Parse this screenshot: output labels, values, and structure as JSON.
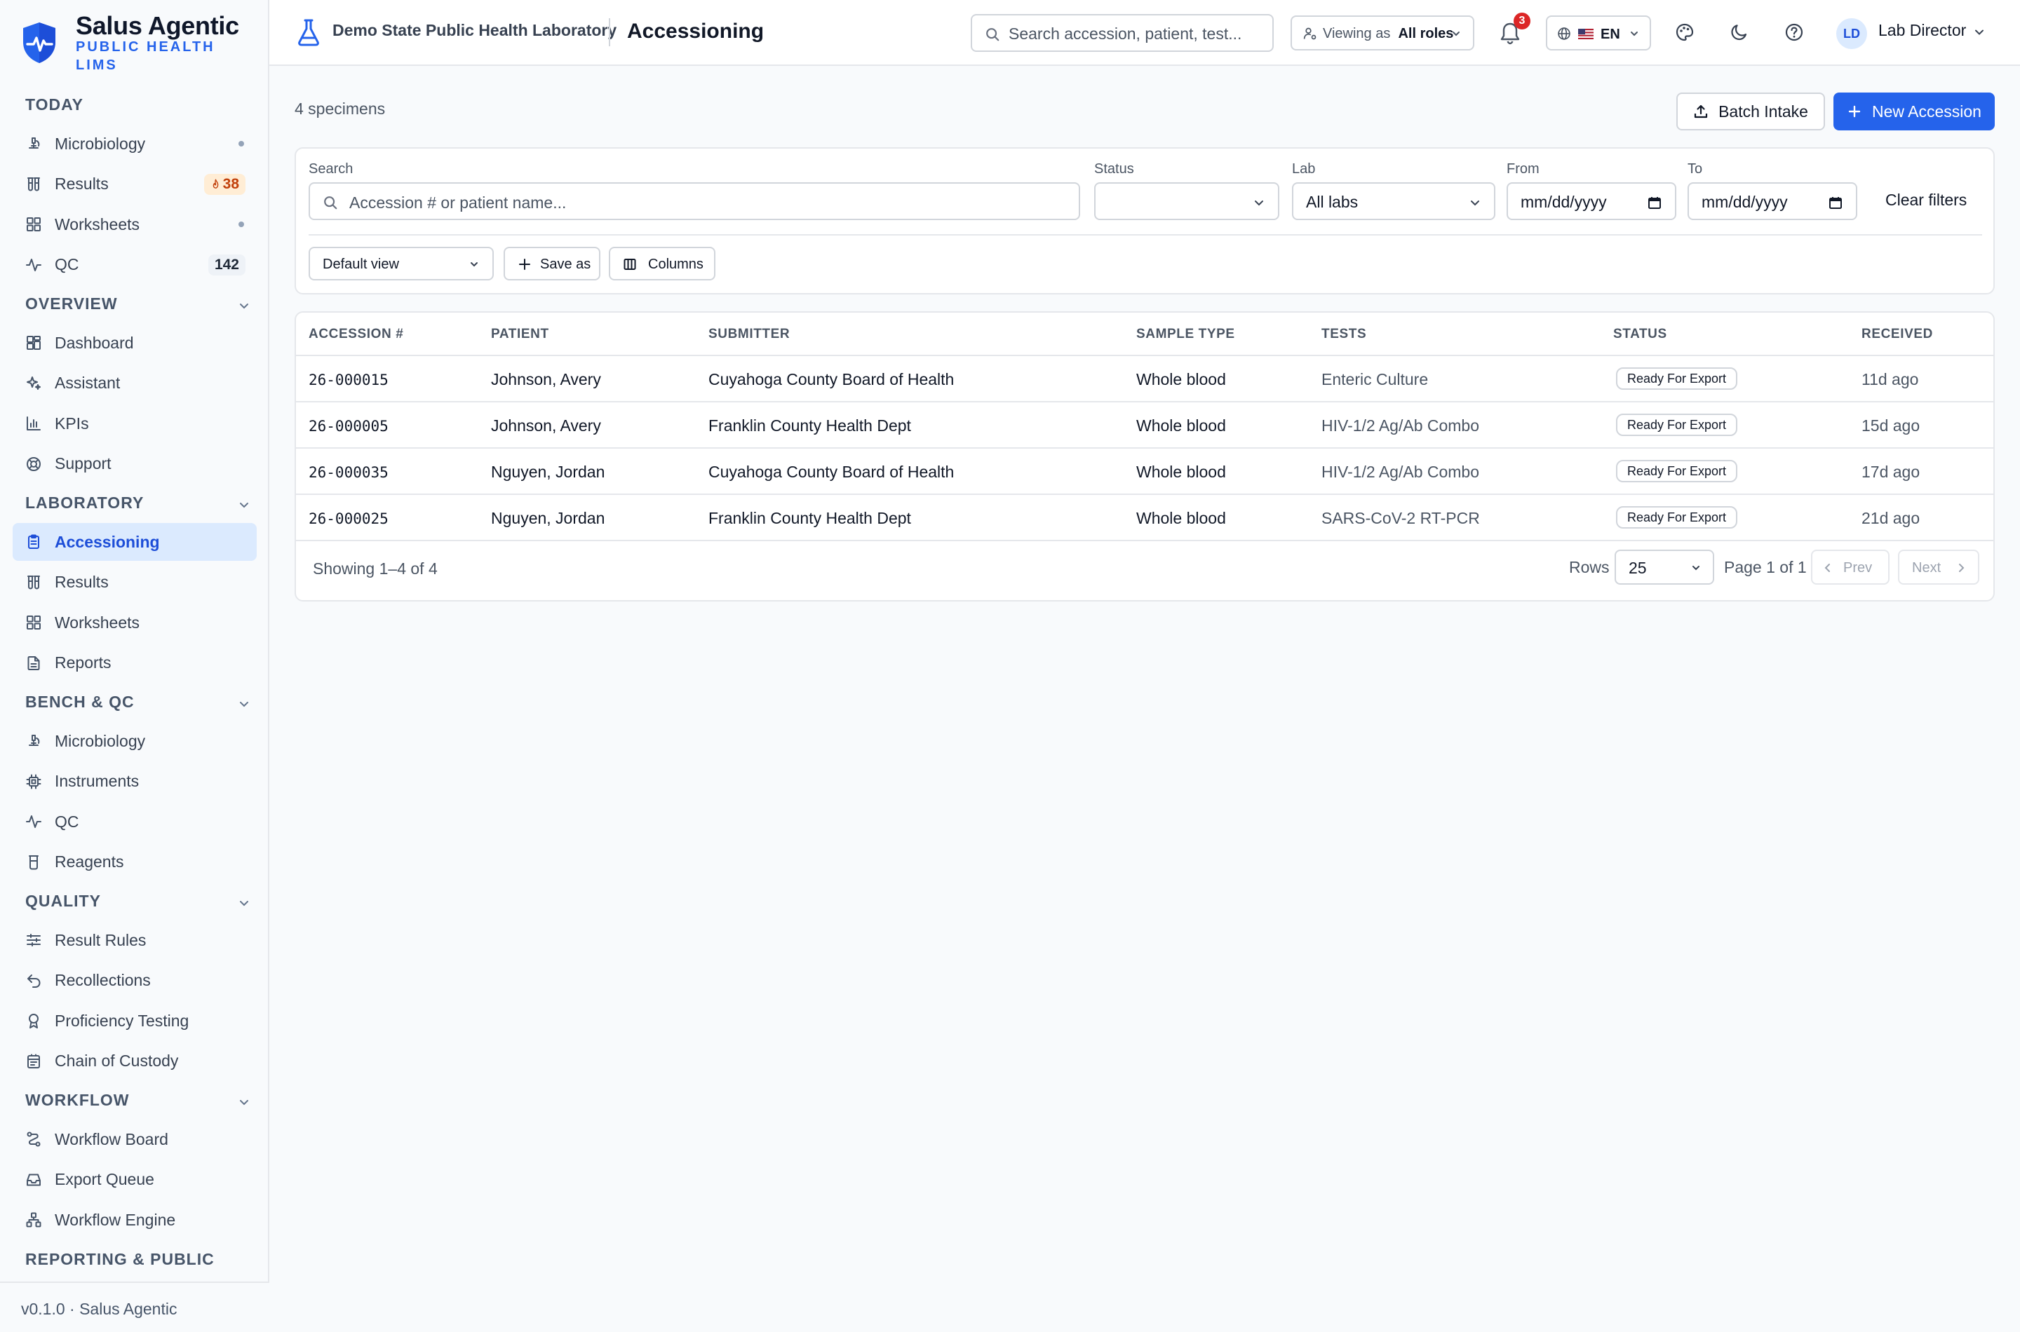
{
  "brand": {
    "name": "Salus Agentic",
    "subtitle": "PUBLIC HEALTH LIMS",
    "version_footer": "v0.1.0 · Salus Agentic"
  },
  "sidebar": {
    "sections": [
      {
        "title": "TODAY",
        "items": [
          {
            "label": "Microbiology",
            "icon": "microscope-icon",
            "dot": true
          },
          {
            "label": "Results",
            "icon": "test-tubes-icon",
            "badge": "38",
            "badge_icon": "flame-icon"
          },
          {
            "label": "Worksheets",
            "icon": "grid-icon",
            "dot": true
          },
          {
            "label": "QC",
            "icon": "activity-icon",
            "badge": "142"
          }
        ]
      },
      {
        "title": "OVERVIEW",
        "items": [
          {
            "label": "Dashboard",
            "icon": "dashboard-icon"
          },
          {
            "label": "Assistant",
            "icon": "sparkles-icon"
          },
          {
            "label": "KPIs",
            "icon": "bar-chart-icon"
          },
          {
            "label": "Support",
            "icon": "life-buoy-icon"
          }
        ]
      },
      {
        "title": "LABORATORY",
        "items": [
          {
            "label": "Accessioning",
            "icon": "clipboard-icon",
            "active": true
          },
          {
            "label": "Results",
            "icon": "test-tubes-icon"
          },
          {
            "label": "Worksheets",
            "icon": "grid-icon"
          },
          {
            "label": "Reports",
            "icon": "file-text-icon"
          }
        ]
      },
      {
        "title": "BENCH & QC",
        "items": [
          {
            "label": "Microbiology",
            "icon": "microscope-icon"
          },
          {
            "label": "Instruments",
            "icon": "cpu-icon"
          },
          {
            "label": "QC",
            "icon": "activity-icon"
          },
          {
            "label": "Reagents",
            "icon": "beaker-icon"
          }
        ]
      },
      {
        "title": "QUALITY",
        "items": [
          {
            "label": "Result Rules",
            "icon": "sliders-icon"
          },
          {
            "label": "Recollections",
            "icon": "undo-icon"
          },
          {
            "label": "Proficiency Testing",
            "icon": "award-icon"
          },
          {
            "label": "Chain of Custody",
            "icon": "clipboard-list-icon"
          }
        ]
      },
      {
        "title": "WORKFLOW",
        "items": [
          {
            "label": "Workflow Board",
            "icon": "route-icon"
          },
          {
            "label": "Export Queue",
            "icon": "inbox-icon"
          },
          {
            "label": "Workflow Engine",
            "icon": "network-icon"
          }
        ]
      },
      {
        "title": "REPORTING & PUBLIC",
        "items": []
      }
    ]
  },
  "topbar": {
    "lab_name": "Demo State Public Health Laboratory",
    "page_title": "Accessioning",
    "search_placeholder": "Search accession, patient, test...",
    "viewing_as_label": "Viewing as",
    "viewing_as_value": "All roles",
    "notification_count": "3",
    "language": "EN",
    "user_initials": "LD",
    "user_name": "Lab Director"
  },
  "main": {
    "specimen_count": "4 specimens",
    "batch_intake_label": "Batch Intake",
    "new_accession_label": "New Accession",
    "filters": {
      "search_label": "Search",
      "search_placeholder": "Accession # or patient name...",
      "status_label": "Status",
      "status_value": "",
      "lab_label": "Lab",
      "lab_value": "All labs",
      "from_label": "From",
      "from_placeholder": "mm/dd/yyyy",
      "to_label": "To",
      "to_placeholder": "mm/dd/yyyy",
      "clear_label": "Clear filters",
      "view_value": "Default view",
      "save_as_label": "Save as",
      "columns_label": "Columns"
    },
    "table": {
      "headers": [
        "ACCESSION #",
        "PATIENT",
        "SUBMITTER",
        "SAMPLE TYPE",
        "TESTS",
        "STATUS",
        "RECEIVED"
      ],
      "rows": [
        {
          "accession": "26-000015",
          "patient": "Johnson, Avery",
          "submitter": "Cuyahoga County Board of Health",
          "sample_type": "Whole blood",
          "tests": "Enteric Culture",
          "status": "Ready For Export",
          "received": "11d ago"
        },
        {
          "accession": "26-000005",
          "patient": "Johnson, Avery",
          "submitter": "Franklin County Health Dept",
          "sample_type": "Whole blood",
          "tests": "HIV-1/2 Ag/Ab Combo",
          "status": "Ready For Export",
          "received": "15d ago"
        },
        {
          "accession": "26-000035",
          "patient": "Nguyen, Jordan",
          "submitter": "Cuyahoga County Board of Health",
          "sample_type": "Whole blood",
          "tests": "HIV-1/2 Ag/Ab Combo",
          "status": "Ready For Export",
          "received": "17d ago"
        },
        {
          "accession": "26-000025",
          "patient": "Nguyen, Jordan",
          "submitter": "Franklin County Health Dept",
          "sample_type": "Whole blood",
          "tests": "SARS-CoV-2 RT-PCR",
          "status": "Ready For Export",
          "received": "21d ago"
        }
      ],
      "showing": "Showing 1–4 of 4",
      "rows_label": "Rows",
      "rows_value": "25",
      "page_text": "Page 1 of 1",
      "prev_label": "Prev",
      "next_label": "Next"
    }
  },
  "colors": {
    "accent": "#2563eb",
    "active_nav_bg": "#dbeafe",
    "warning_badge": "#c2410c",
    "notification": "#dc2626"
  }
}
